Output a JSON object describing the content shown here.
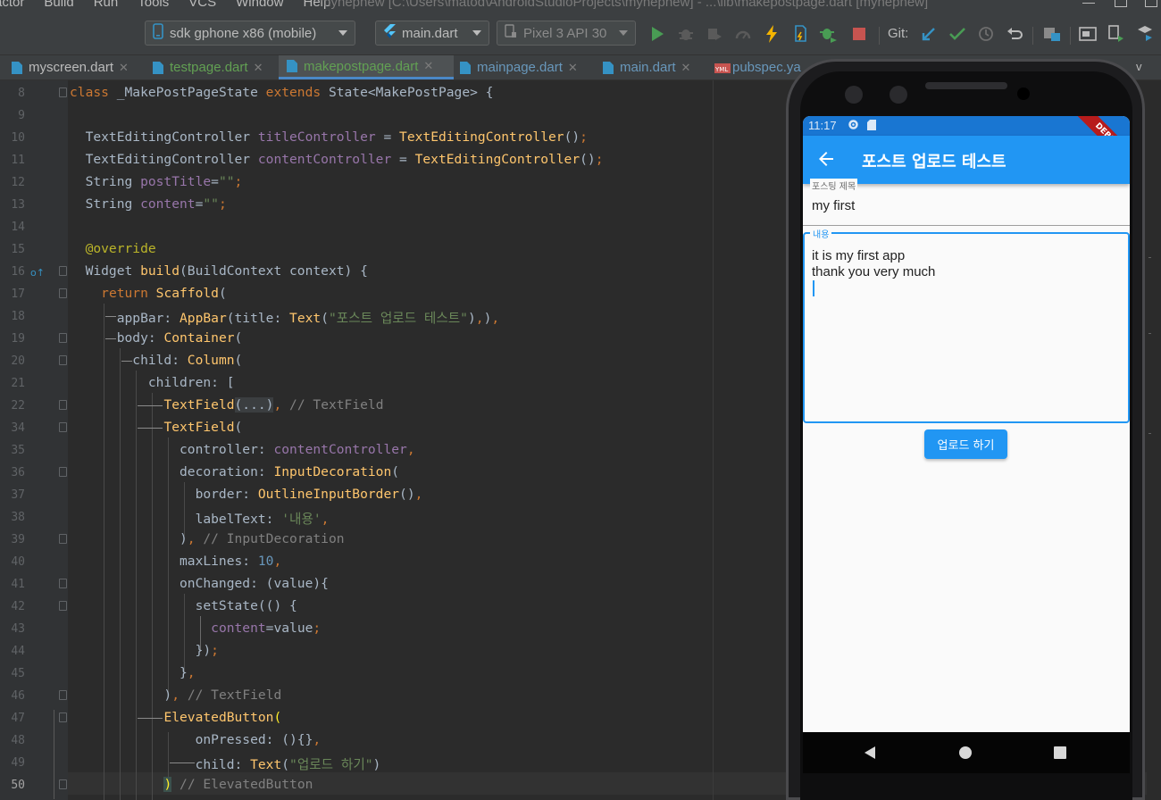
{
  "menu": {
    "items": [
      "actor",
      "Build",
      "Run",
      "Tools",
      "VCS",
      "Window",
      "Help"
    ],
    "window_title": "mynepnew [C:\\Users\\matod\\AndroidStudioProjects\\mynepnew] - ...\\lib\\makepostpage.dart [mynepnew]"
  },
  "toolbar": {
    "device": "sdk gphone x86 (mobile)",
    "run_config": "main.dart",
    "avd": "Pixel 3 API 30",
    "git_label": "Git:"
  },
  "tabs": [
    {
      "label": "myscreen.dart",
      "color": "#bbbbbb",
      "active": false
    },
    {
      "label": "testpage.dart",
      "color": "#62a053",
      "active": false
    },
    {
      "label": "makepostpage.dart",
      "color": "#62a053",
      "active": true
    },
    {
      "label": "mainpage.dart",
      "color": "#6897bb",
      "active": false
    },
    {
      "label": "main.dart",
      "color": "#6897bb",
      "active": false
    },
    {
      "label": "pubspec.ya",
      "color": "#6897bb",
      "active": false
    }
  ],
  "tab_overflow": "v",
  "editor": {
    "line_numbers": [
      "8",
      "9",
      "10",
      "11",
      "12",
      "13",
      "14",
      "15",
      "16",
      "17",
      "18",
      "19",
      "20",
      "21",
      "22",
      "34",
      "35",
      "36",
      "37",
      "38",
      "39",
      "40",
      "41",
      "42",
      "43",
      "44",
      "45",
      "46",
      "47",
      "48",
      "49",
      "50"
    ],
    "current_line": "50"
  },
  "emulator": {
    "status_time": "11:17",
    "appbar_title": "포스트 업로드 테스트",
    "debug_banner": "DEBUG",
    "title_field_label": "포스팅 제목",
    "title_field_value": "my first",
    "content_field_label": "내용",
    "content_line1": "it is my first app",
    "content_line2": "thank you very much",
    "upload_button": "업로드 하기"
  },
  "colors": {
    "ide_background": "#2b2b2b",
    "flutter_primary": "#2196f3",
    "status_bar": "#1976d2"
  },
  "icons": [
    "phone-icon",
    "flutter-icon",
    "device-icon",
    "run-icon",
    "debug-icon",
    "profile-icon",
    "hot-reload-icon",
    "stop-icon",
    "git-update-icon",
    "git-commit-icon",
    "git-history-icon",
    "git-rollback-icon",
    "back-arrow-icon",
    "settings-icon",
    "sd-card-icon"
  ]
}
